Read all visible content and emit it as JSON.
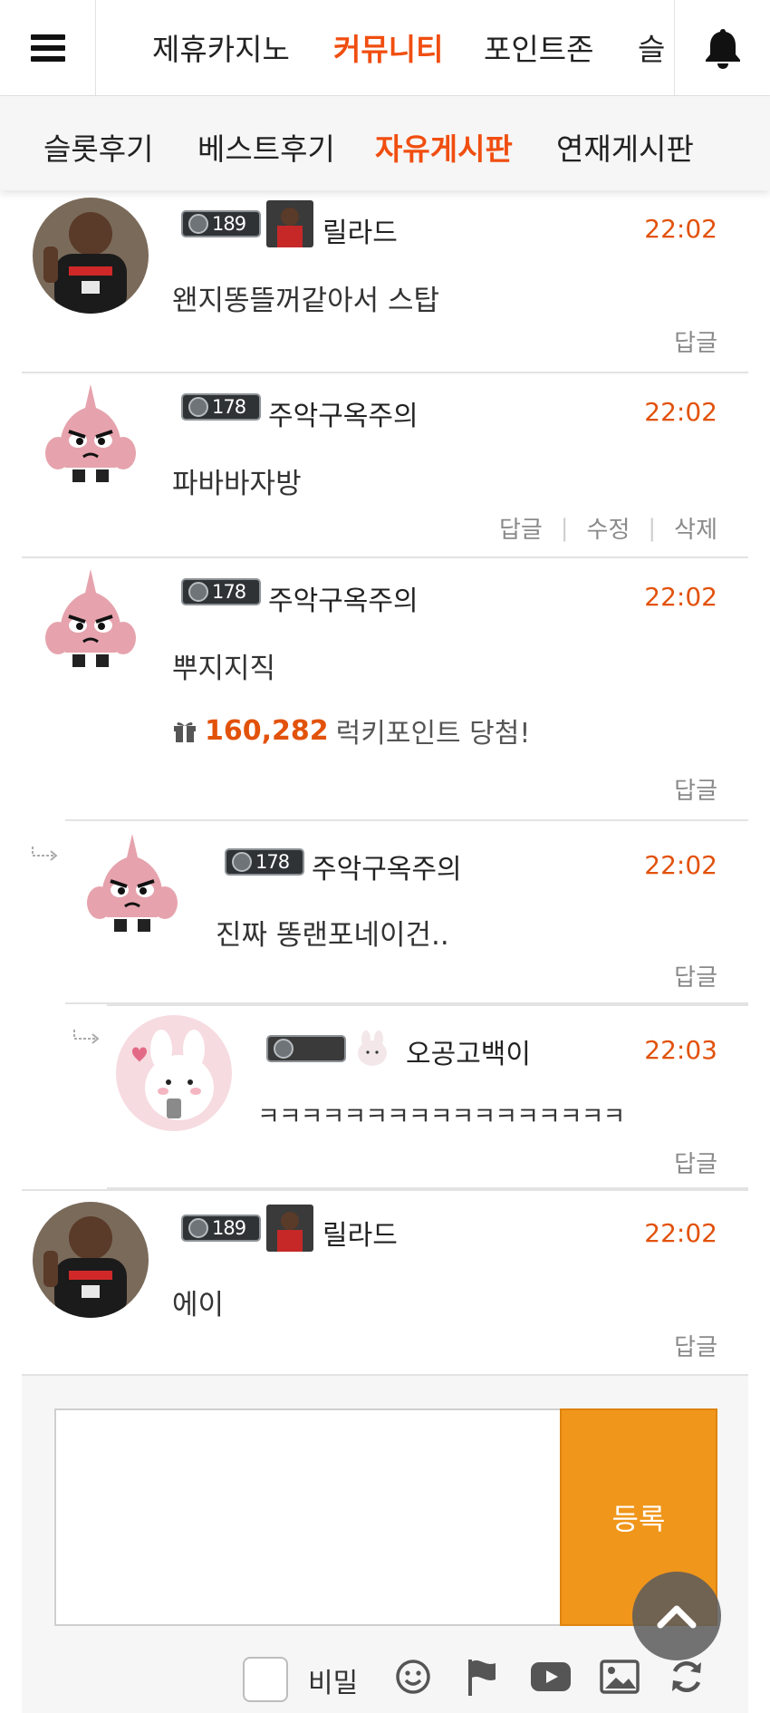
{
  "top_nav": {
    "items": [
      {
        "label": "제휴카지노"
      },
      {
        "label": "커뮤니티",
        "active": true
      },
      {
        "label": "포인트존"
      },
      {
        "label": "슬"
      }
    ],
    "menu_icon": "hamburger-menu-icon",
    "bell_icon": "bell-icon"
  },
  "sub_nav": {
    "items": [
      {
        "label": "슬롯후기"
      },
      {
        "label": "베스트후기"
      },
      {
        "label": "자유게시판",
        "active": true
      },
      {
        "label": "연재게시판"
      }
    ]
  },
  "comments": [
    {
      "nickname": "릴라드",
      "level": "189",
      "time": "22:02",
      "text": "왠지똥뜰꺼같아서 스탑",
      "actions": [
        "답글"
      ],
      "avatar": "basketball-player-avatar"
    },
    {
      "nickname": "주악구옥주의",
      "level": "178",
      "time": "22:02",
      "text": "파바바자방",
      "actions": [
        "답글",
        "수정",
        "삭제"
      ],
      "avatar": "garlic-character-avatar"
    },
    {
      "nickname": "주악구옥주의",
      "level": "178",
      "time": "22:02",
      "text": "뿌지지직",
      "lucky": {
        "amount": "160,282",
        "label": "럭키포인트 당첨!"
      },
      "actions": [
        "답글"
      ],
      "avatar": "garlic-character-avatar"
    },
    {
      "nickname": "주악구옥주의",
      "level": "178",
      "time": "22:02",
      "text": "진짜 똥랜포네이건..",
      "actions": [
        "답글"
      ],
      "avatar": "garlic-character-avatar",
      "reply": true
    },
    {
      "nickname": "오공고백이",
      "level": "",
      "time": "22:03",
      "text": "ㅋㅋㅋㅋㅋㅋㅋㅋㅋㅋㅋㅋㅋㅋㅋㅋㅋ",
      "actions": [
        "답글"
      ],
      "avatar": "bunny-character-avatar",
      "reply": true
    },
    {
      "nickname": "릴라드",
      "level": "189",
      "time": "22:02",
      "text": "에이",
      "actions": [
        "답글"
      ],
      "avatar": "basketball-player-avatar"
    }
  ],
  "write_form": {
    "submit_label": "등록",
    "secret_label": "비밀",
    "tools": [
      "emoji-icon",
      "flag-icon",
      "youtube-icon",
      "image-icon",
      "refresh-icon"
    ]
  },
  "colors": {
    "accent": "#f04e10",
    "time": "#e2520b",
    "submit": "#f0961b"
  }
}
